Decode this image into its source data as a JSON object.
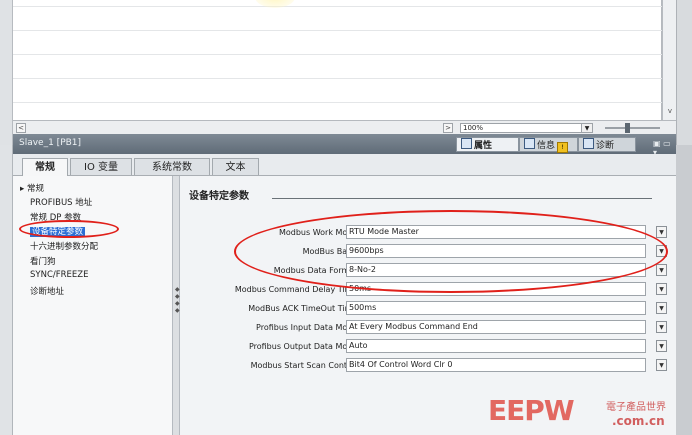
{
  "canvas": {
    "zoom_value": "100%",
    "scroll_left": "<",
    "scroll_right": ">",
    "scroll_down": "v"
  },
  "inspector": {
    "title": "Slave_1 [PB1]",
    "panel_tabs": [
      {
        "label": "属性"
      },
      {
        "label": "信息"
      },
      {
        "label": "诊断"
      }
    ],
    "tabs": [
      {
        "label": "常规"
      },
      {
        "label": "IO 变量"
      },
      {
        "label": "系统常数"
      },
      {
        "label": "文本"
      }
    ]
  },
  "tree": {
    "root": "▸ 常规",
    "items": [
      {
        "label": "PROFIBUS 地址"
      },
      {
        "label": "常规 DP 参数"
      },
      {
        "label": "设备特定参数"
      },
      {
        "label": "十六进制参数分配"
      },
      {
        "label": "看门狗"
      },
      {
        "label": "SYNC/FREEZE"
      },
      {
        "label": "诊断地址"
      }
    ]
  },
  "main": {
    "section_title": "设备特定参数",
    "params": [
      {
        "label": "Modbus Work Mode:",
        "value": "RTU Mode Master"
      },
      {
        "label": "ModBus Baud:",
        "value": "9600bps"
      },
      {
        "label": "Modbus Data Format:",
        "value": "8-No-2"
      },
      {
        "label": "Modbus Command Delay Time:",
        "value": "50ms"
      },
      {
        "label": "ModBus ACK TimeOut Time:",
        "value": "500ms"
      },
      {
        "label": "Profibus Input Data Mode:",
        "value": "At Every Modbus Command End"
      },
      {
        "label": "Profibus Output Data Mode:",
        "value": "Auto"
      },
      {
        "label": "Modbus Start Scan Control:",
        "value": "Bit4 Of Control Word Clr 0"
      }
    ]
  },
  "watermark": {
    "logo": "EEPW",
    "cn": "電子產品世界",
    "url": ".com.cn"
  },
  "colors": {
    "annotation_red": "#e0201a",
    "selection_blue": "#2c6fd6"
  }
}
